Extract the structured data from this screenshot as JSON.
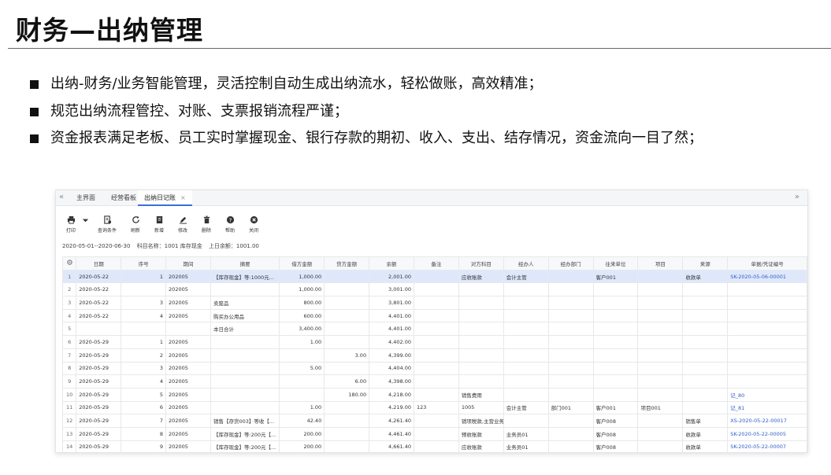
{
  "slide": {
    "title": "财务—出纳管理",
    "bullets": [
      "出纳-财务/业务智能管理，灵活控制自动生成出纳流水，轻松做账，高效精准；",
      "规范出纳流程管控、对账、支票报销流程严谨；",
      "资金报表满足老板、员工实时掌握现金、银行存款的期初、收入、支出、结存情况，资金流向一目了然；"
    ]
  },
  "app": {
    "tabs": [
      {
        "label": "主界面"
      },
      {
        "label": "经营看板"
      },
      {
        "label": "出纳日记账",
        "active": true,
        "close": "×"
      }
    ],
    "nav_left": "«",
    "nav_right": "»",
    "toolbar": {
      "print": "打印",
      "query": "查询条件",
      "refresh": "刷新",
      "add": "新增",
      "edit": "修改",
      "delete": "删除",
      "help": "帮助",
      "close": "关闭"
    },
    "info": {
      "date_range": "2020-05-01--2020-06-30",
      "account": "科目名称：1001 库存现金",
      "prev_balance": "上日余额：1001.00"
    },
    "columns": [
      "",
      "日期",
      "序号",
      "期间",
      "摘要",
      "借方金额",
      "贷方金额",
      "余额",
      "备注",
      "对方科目",
      "经办人",
      "经办部门",
      "往来单位",
      "项目",
      "来源",
      "单据/凭证编号"
    ],
    "rows": [
      [
        "1",
        "2020-05-22",
        "1",
        "202005",
        "【库存现金】等:1000元...",
        "1,000.00",
        "",
        "2,001.00",
        "",
        "应收账款",
        "会计主管",
        "",
        "客户001",
        "",
        "收款单",
        "SK-2020-05-06-00001"
      ],
      [
        "2",
        "2020-05-22",
        "",
        "202005",
        "",
        "1,000.00",
        "",
        "3,001.00",
        "",
        "",
        "",
        "",
        "",
        "",
        "",
        ""
      ],
      [
        "3",
        "2020-05-22",
        "3",
        "202005",
        "卖废品",
        "800.00",
        "",
        "3,801.00",
        "",
        "",
        "",
        "",
        "",
        "",
        "",
        ""
      ],
      [
        "4",
        "2020-05-22",
        "4",
        "202005",
        "购买办公用品",
        "600.00",
        "",
        "4,401.00",
        "",
        "",
        "",
        "",
        "",
        "",
        "",
        ""
      ],
      [
        "5",
        "",
        "",
        "",
        "本日合计",
        "3,400.00",
        "",
        "4,401.00",
        "",
        "",
        "",
        "",
        "",
        "",
        "",
        ""
      ],
      [
        "6",
        "2020-05-29",
        "1",
        "202005",
        "",
        "1.00",
        "",
        "4,402.00",
        "",
        "",
        "",
        "",
        "",
        "",
        "",
        ""
      ],
      [
        "7",
        "2020-05-29",
        "2",
        "202005",
        "",
        "",
        "3.00",
        "4,399.00",
        "",
        "",
        "",
        "",
        "",
        "",
        "",
        ""
      ],
      [
        "8",
        "2020-05-29",
        "3",
        "202005",
        "",
        "5.00",
        "",
        "4,404.00",
        "",
        "",
        "",
        "",
        "",
        "",
        "",
        ""
      ],
      [
        "9",
        "2020-05-29",
        "4",
        "202005",
        "",
        "",
        "6.00",
        "4,398.00",
        "",
        "",
        "",
        "",
        "",
        "",
        "",
        ""
      ],
      [
        "10",
        "2020-05-29",
        "5",
        "202005",
        "",
        "",
        "180.00",
        "4,218.00",
        "",
        "销售费用",
        "",
        "",
        "",
        "",
        "",
        "记_80"
      ],
      [
        "11",
        "2020-05-29",
        "6",
        "202005",
        "",
        "1.00",
        "",
        "4,219.00",
        "123",
        "1005",
        "会计主管",
        "部门001",
        "客户001",
        "项目001",
        "",
        "记_81"
      ],
      [
        "12",
        "2020-05-29",
        "7",
        "202005",
        "销售【存货003】等收【...",
        "42.40",
        "",
        "4,261.40",
        "",
        "销项税款,主营业务...",
        "",
        "",
        "客户008",
        "",
        "销售单",
        "XS-2020-05-22-00017"
      ],
      [
        "13",
        "2020-05-29",
        "8",
        "202005",
        "【库存现金】等:200元【...",
        "200.00",
        "",
        "4,461.40",
        "",
        "预收账款",
        "业务员01",
        "",
        "客户008",
        "",
        "收款单",
        "SK-2020-05-22-00005"
      ],
      [
        "14",
        "2020-05-29",
        "9",
        "202005",
        "【库存现金】等:200元【...",
        "200.00",
        "",
        "4,661.40",
        "",
        "应收账款",
        "业务员01",
        "",
        "客户008",
        "",
        "收款单",
        "SK-2020-05-22-00007"
      ]
    ]
  }
}
